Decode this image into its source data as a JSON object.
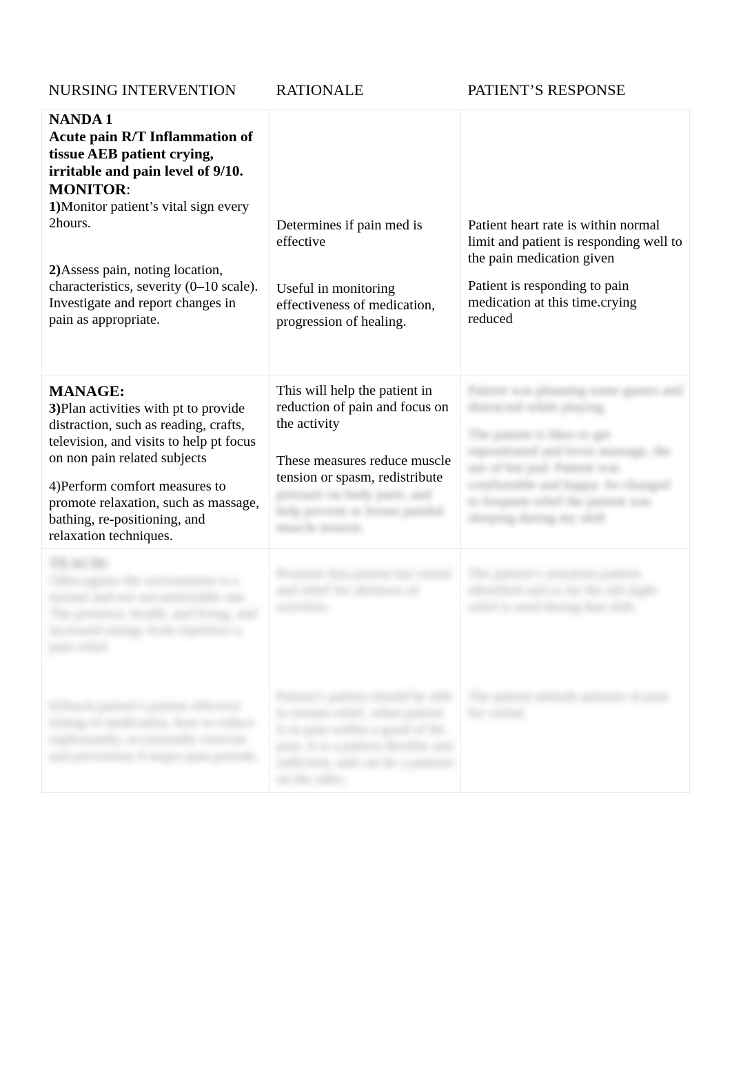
{
  "document": {
    "type": "nursing-care-plan-table",
    "column_headers": [
      "NURSING INTERVENTION",
      "RATIONALE",
      "PATIENT’S RESPONSE"
    ]
  },
  "row_monitor": {
    "intervention": {
      "nanda_label": "NANDA 1",
      "diagnosis": "Acute pain R/T Inflammation of tissue AEB patient crying, irritable and pain level of 9/10.",
      "section_heading": "MONITOR",
      "section_heading_punct": ":",
      "item1_number": "1)",
      "item1_text": "Monitor patient’s vital sign every 2hours.",
      "item2_number": "2)",
      "item2_text": "Assess pain, noting location, characteristics, severity (0–10 scale). Investigate and report changes in pain as appropriate."
    },
    "rationale": {
      "item1": "Determines if pain med is effective",
      "item2": "Useful in monitoring effectiveness of medication, progression of healing."
    },
    "response": {
      "item1": "Patient heart rate is within normal limit and patient is responding well to the pain medication given",
      "item2": "Patient is responding to pain medication at this time.crying reduced"
    }
  },
  "row_manage": {
    "intervention": {
      "section_heading": "MANAGE:",
      "item3_number": "3)",
      "item3_text": "Plan activities with pt to provide distraction, such as reading, crafts, television, and visits to help pt focus on non pain related subjects",
      "item4_number": "4)",
      "item4_text": "Perform comfort measures to promote relaxation, such as massage, bathing, re-positioning, and relaxation techniques."
    },
    "rationale": {
      "item3": "This will help the patient in reduction of pain and focus on the activity",
      "item4_visible": "These measures reduce muscle tension or spasm, redistribute",
      "item4_obscured": "pressure on body parts, and help prevent or lessen painful muscle tension."
    },
    "response": {
      "item3_obscured": "Patient was planning some games and distracted while playing",
      "item4_obscured": "The patient is likes to get repositioned and loves massage, the use of hot pad. Patient was comfortable and happy. So changed to frequent relief the patient was sleeping during my shift"
    }
  },
  "row_obscured": {
    "intervention": {
      "section_heading_obscured": "TEACH:",
      "item5_obscured": "5)Recognize the environment is a normal and not uncomfortable one. The presence, health, and living, and increased energy from repetitive a pain relief.",
      "item6_obscured": "6)Teach patient’s patient effective timing of medication, how to reduce unpleasantly, occasionally exercise and prevention if major pain periods."
    },
    "rationale": {
      "item5_obscured": "Promote that patient has rested and relief for alertness of activities.",
      "item6_obscured": "Patient’s pattern should be able to remain relief, when patient is in pain within a good of the pain. It is a pattern flexible and sufficient, and can be a patients on the sides."
    },
    "response": {
      "item5_obscured": "The patient’s sensation pattern identified and so far the old night relief is used during that shift.",
      "item6_obscured": "The patient attitude patients of pain for verbal."
    }
  }
}
